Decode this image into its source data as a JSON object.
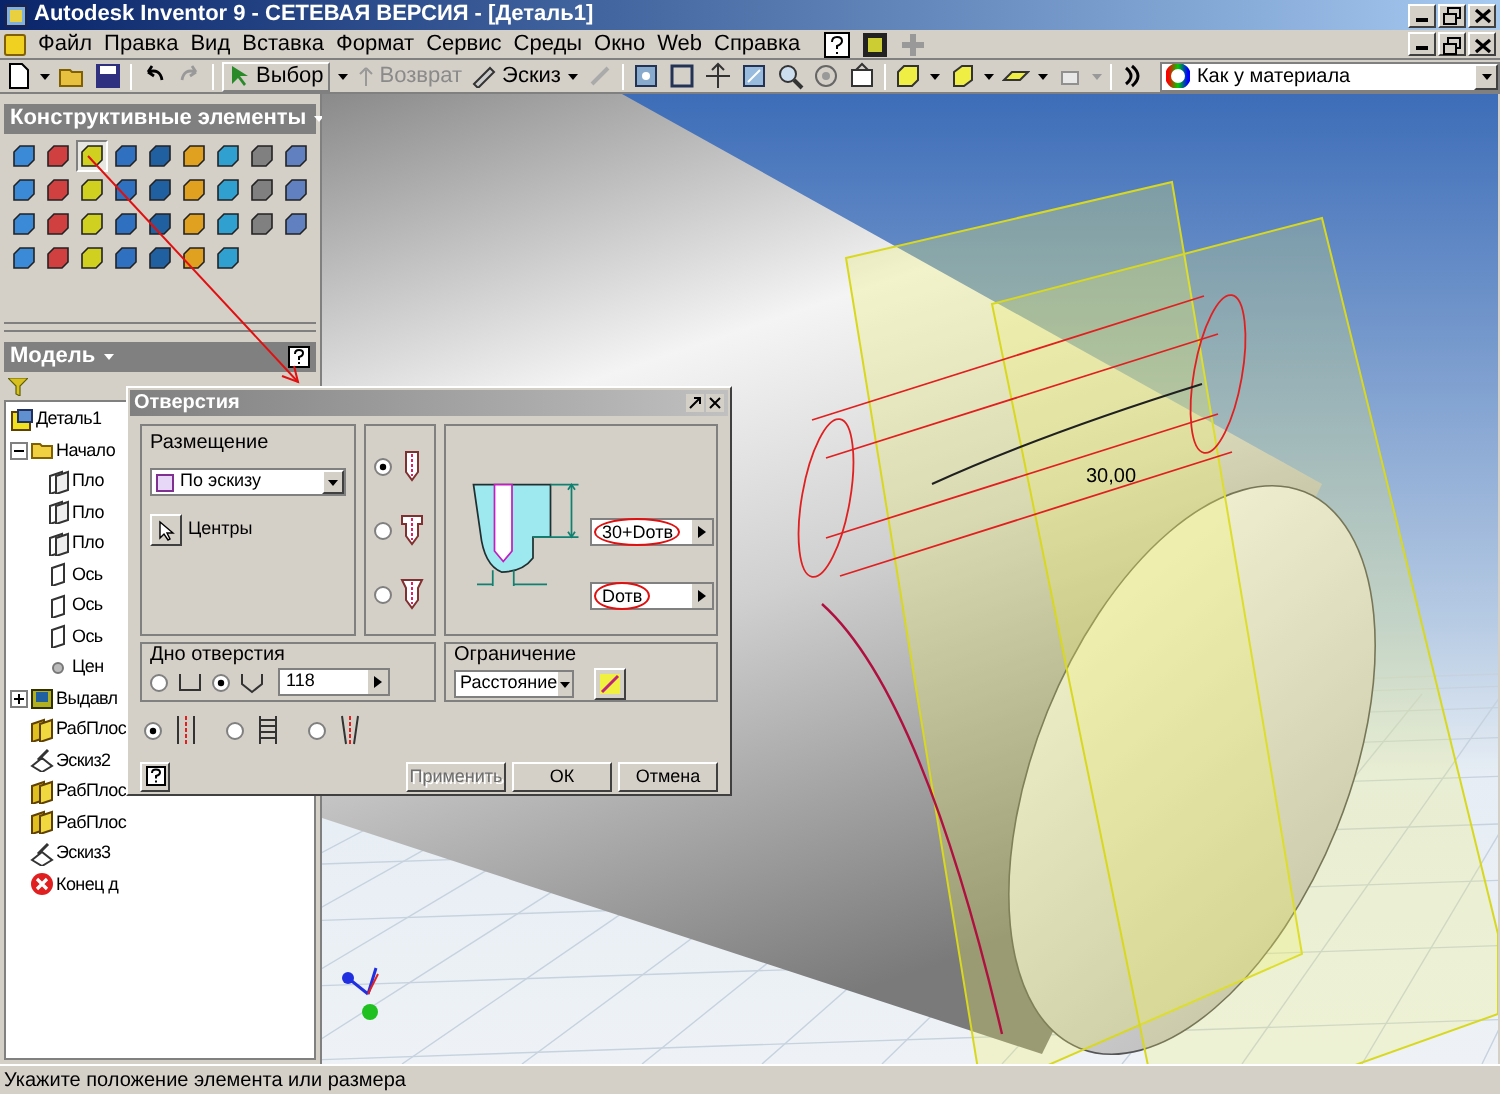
{
  "window": {
    "title": "Autodesk Inventor 9  - СЕТЕВАЯ ВЕРСИЯ - [Деталь1]"
  },
  "menu": [
    "Файл",
    "Правка",
    "Вид",
    "Вставка",
    "Формат",
    "Сервис",
    "Среды",
    "Окно",
    "Web",
    "Справка"
  ],
  "toolbar": {
    "select": "Выбор",
    "return": "Возврат",
    "sketch": "Эскиз",
    "material": "Как у материала"
  },
  "features_panel": {
    "title": "Конструктивные элементы"
  },
  "browser": {
    "title": "Модель",
    "tree": [
      {
        "label": "Деталь1",
        "kind": "part",
        "children": [
          {
            "label": "Начало",
            "kind": "folder",
            "expanded": true,
            "children": [
              {
                "label": "Пло",
                "kind": "plane"
              },
              {
                "label": "Пло",
                "kind": "plane"
              },
              {
                "label": "Пло",
                "kind": "plane"
              },
              {
                "label": "Ось",
                "kind": "axis"
              },
              {
                "label": "Ось",
                "kind": "axis"
              },
              {
                "label": "Ось",
                "kind": "axis"
              },
              {
                "label": "Цен",
                "kind": "point"
              }
            ]
          },
          {
            "label": "Выдавл",
            "kind": "extrusion",
            "expanded": false
          },
          {
            "label": "РабПлос",
            "kind": "workplane"
          },
          {
            "label": "Эскиз2",
            "kind": "sketch"
          },
          {
            "label": "РабПлос",
            "kind": "workplane"
          },
          {
            "label": "РабПлос",
            "kind": "workplane"
          },
          {
            "label": "Эскиз3",
            "kind": "sketch"
          },
          {
            "label": "Конец д",
            "kind": "end"
          }
        ]
      }
    ]
  },
  "viewport": {
    "dimension": "30,00"
  },
  "dialog": {
    "title": "Отверстия",
    "placement_label": "Размещение",
    "placement": "По эскизу",
    "centers": "Центры",
    "hole_types": [
      {
        "kind": "drilled",
        "selected": true
      },
      {
        "kind": "counterbore",
        "selected": false
      },
      {
        "kind": "countersink",
        "selected": false
      }
    ],
    "depth": "30+Dотв",
    "diameter": "Dотв",
    "drill_point_label": "Дно отверстия",
    "drill_points": [
      {
        "kind": "flat",
        "selected": false
      },
      {
        "kind": "angle",
        "selected": true
      }
    ],
    "angle": "118",
    "termination_label": "Ограничение",
    "termination": "Расстояние",
    "threads": [
      {
        "kind": "simple",
        "selected": true
      },
      {
        "kind": "tapped",
        "selected": false
      },
      {
        "kind": "taper",
        "selected": false
      }
    ],
    "buttons": [
      {
        "label": "Применить",
        "disabled": true
      },
      {
        "label": "ОК",
        "disabled": false
      },
      {
        "label": "Отмена",
        "disabled": false
      }
    ]
  },
  "status_bar": "Укажите положение элемента или размера"
}
